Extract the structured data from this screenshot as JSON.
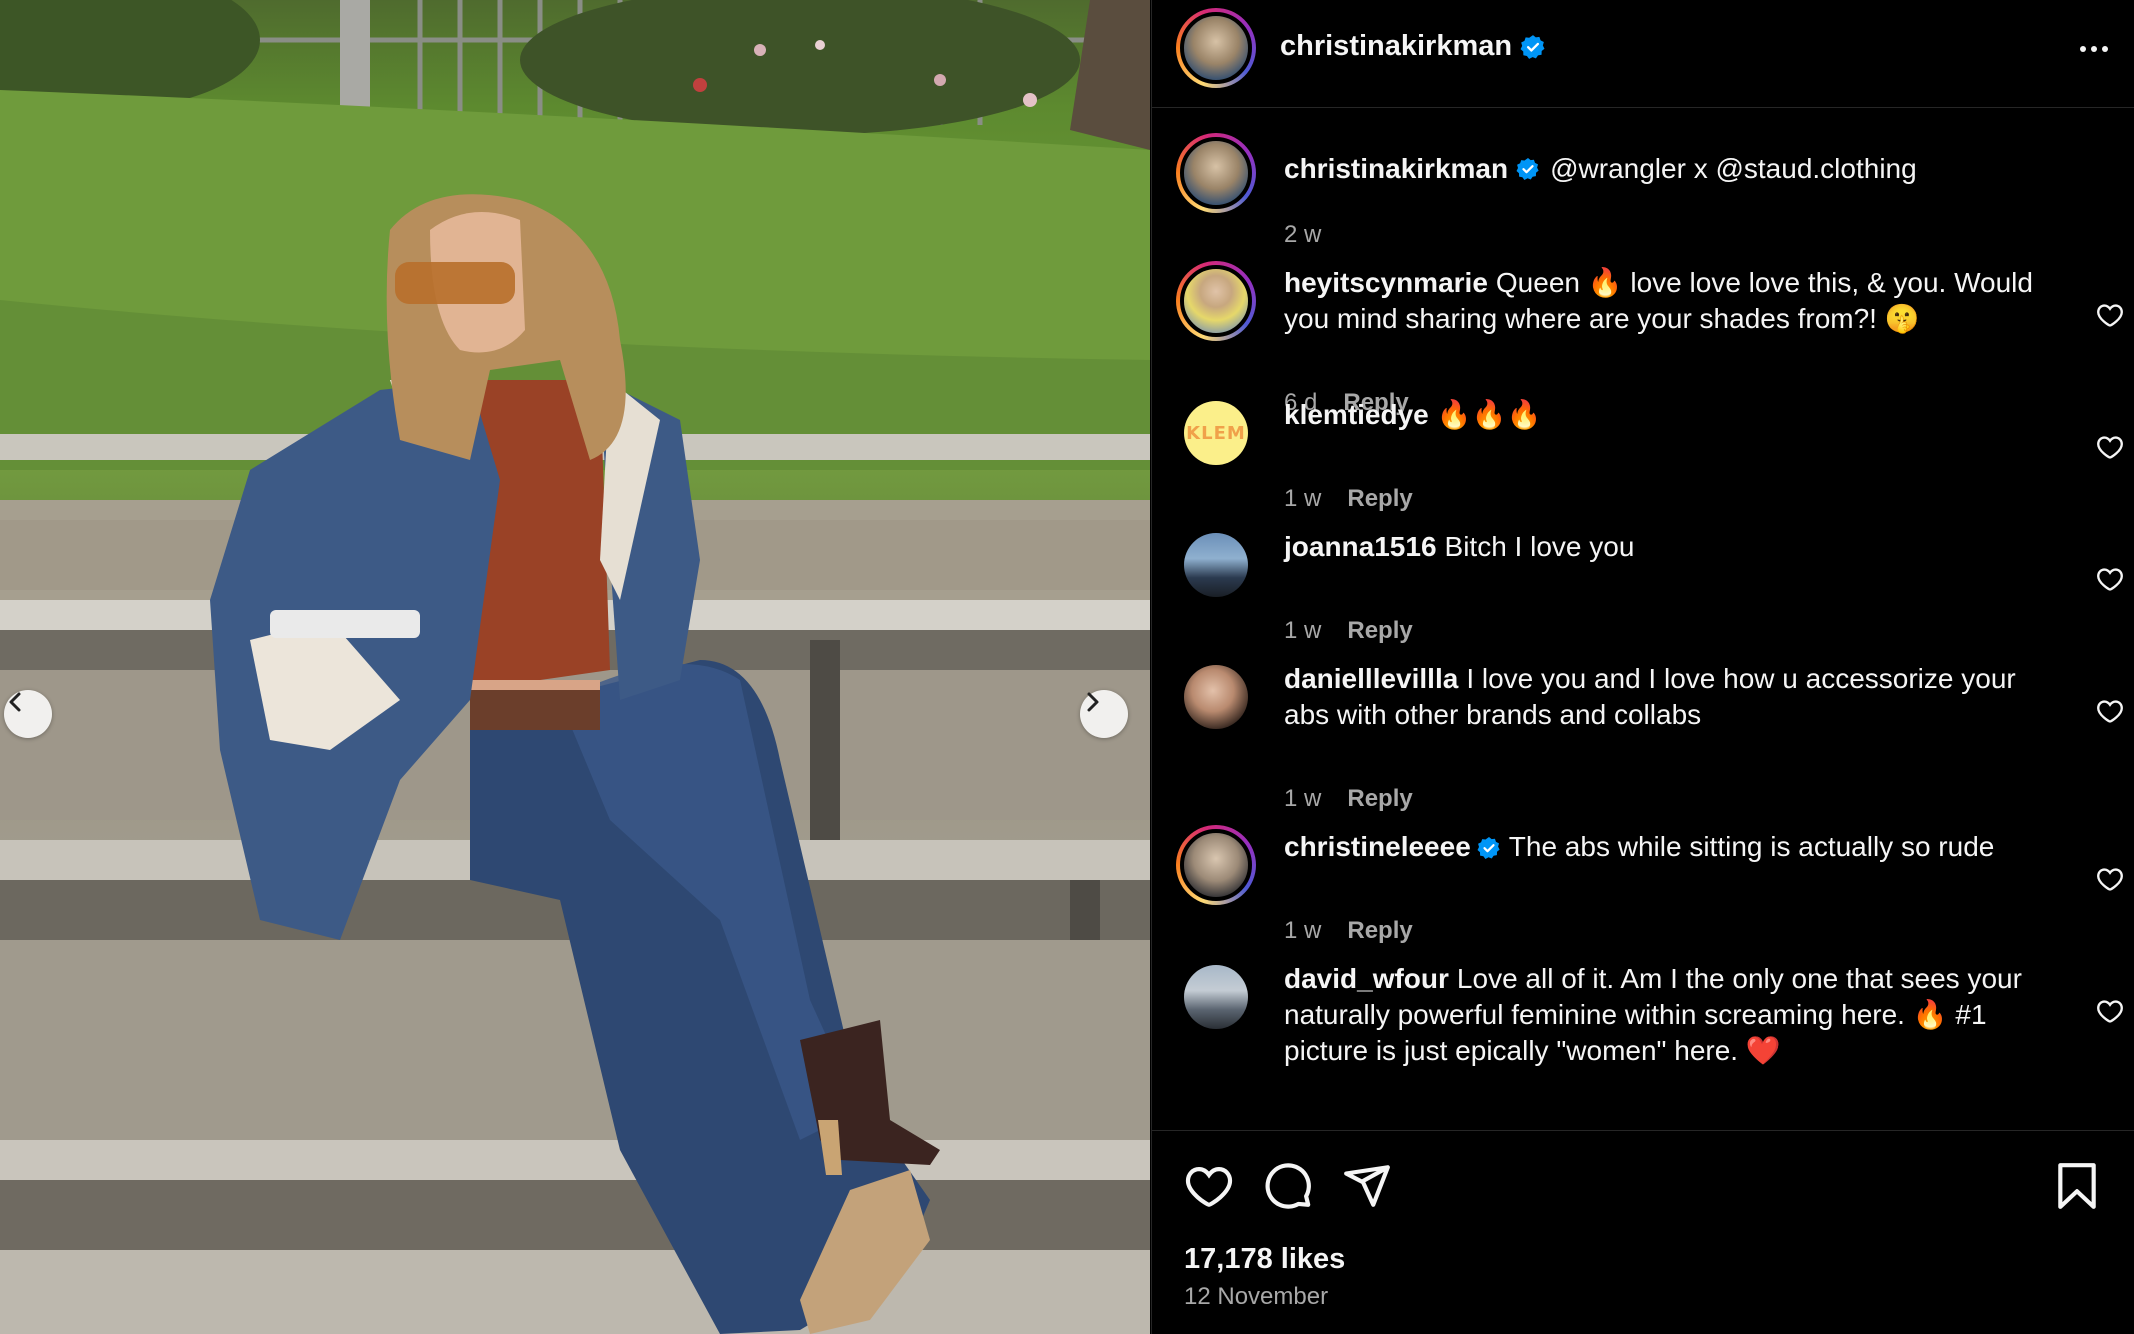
{
  "post": {
    "author": "christinakirkman",
    "caption": "@wrangler x @staud.clothing",
    "caption_time": "2 w",
    "likes": "17,178 likes",
    "date": "12 November"
  },
  "comments": [
    {
      "user": "heyitscynmarie",
      "verified": false,
      "text": "Queen 🔥 love love love this, & you. Would you mind sharing where are your shades from?! 🤫",
      "time": "6 d",
      "reply": "Reply"
    },
    {
      "user": "klemtiedye",
      "verified": false,
      "text": "🔥🔥🔥",
      "time": "1 w",
      "reply": "Reply",
      "avatar_text": "KLEM"
    },
    {
      "user": "joanna1516",
      "verified": false,
      "text": "Bitch I love you",
      "time": "1 w",
      "reply": "Reply"
    },
    {
      "user": "danielllevillla",
      "verified": false,
      "text": "I love you and I love how u accessorize your abs with other brands and collabs",
      "time": "1 w",
      "reply": "Reply"
    },
    {
      "user": "christineleeee",
      "verified": true,
      "text": "The abs while sitting is actually so rude",
      "time": "1 w",
      "reply": "Reply"
    },
    {
      "user": "david_wfour",
      "verified": false,
      "text": "Love all of it. Am I the only one that sees your naturally powerful feminine within screaming here. 🔥 #1 picture is just epically \"women\" here. ❤️",
      "time": "",
      "reply": ""
    }
  ],
  "icons": {
    "like": "heart-icon",
    "comment": "comment-icon",
    "share": "share-icon",
    "save": "bookmark-icon",
    "more": "more-icon",
    "verified": "verified-badge-icon",
    "prev": "chevron-left-icon",
    "next": "chevron-right-icon"
  },
  "colors": {
    "background": "#000000",
    "text": "#f5f5f5",
    "muted": "#a8a8a8",
    "verified": "#0095f6",
    "divider": "#262626"
  }
}
